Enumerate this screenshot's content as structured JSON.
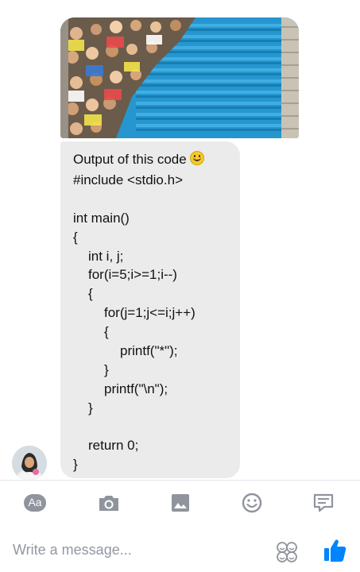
{
  "message": {
    "header": "Output of this code",
    "code_lines": [
      "#include <stdio.h>",
      "",
      "int main()",
      "{",
      "int i, j;",
      "for(i=5;i>=1;i--)",
      "{",
      "for(j=1;j<=i;j++)",
      "{",
      "printf(\"*\");",
      "}",
      "printf(\"\\n\");",
      "}",
      "",
      "return 0;",
      "}"
    ]
  },
  "composer": {
    "placeholder": "Write a message...",
    "aa_label": "Aa"
  },
  "colors": {
    "bubble": "#ebebeb",
    "accent": "#0084ff",
    "icon_gray": "#90949c"
  }
}
